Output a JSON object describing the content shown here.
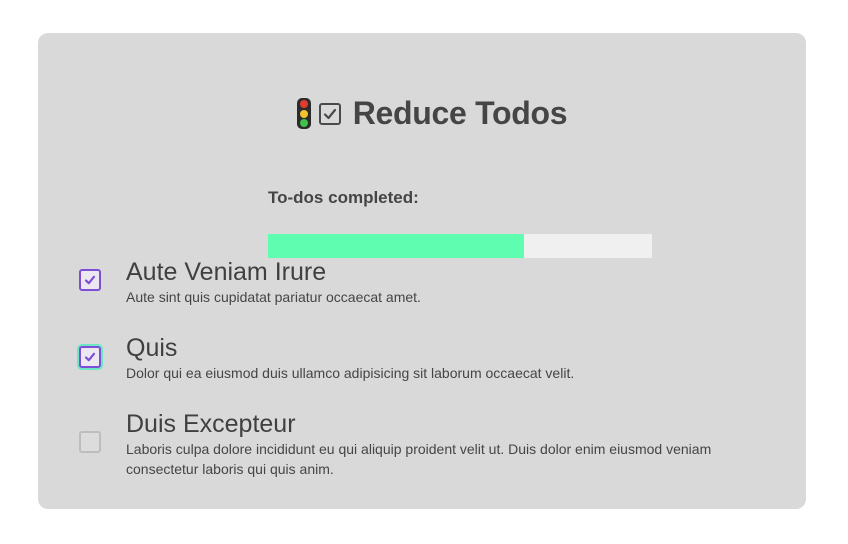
{
  "header": {
    "icons": [
      "traffic-light-icon",
      "check-box-icon"
    ],
    "title": "Reduce Todos"
  },
  "progress": {
    "label": "To-dos completed:",
    "completed": 2,
    "total": 3,
    "fraction": 0.6667,
    "fill_color": "#5ffdb0",
    "track_color": "#f0f0f0"
  },
  "todos": [
    {
      "title": "Aute Veniam Irure",
      "description": "Aute sint quis cupidatat pariatur occaecat amet.",
      "checked": true
    },
    {
      "title": "Quis",
      "description": "Dolor qui ea eiusmod duis ullamco adipisicing sit laborum occaecat velit.",
      "checked": true,
      "focused": true
    },
    {
      "title": "Duis Excepteur",
      "description": "Laboris culpa dolore incididunt eu qui aliquip proident velit ut. Duis dolor enim eiusmod veniam consectetur laboris qui quis anim.",
      "checked": false
    }
  ],
  "colors": {
    "card_background": "#d9d9d9",
    "checkbox_accent": "#7e4fd6",
    "focus_ring": "#6ce6c5"
  }
}
